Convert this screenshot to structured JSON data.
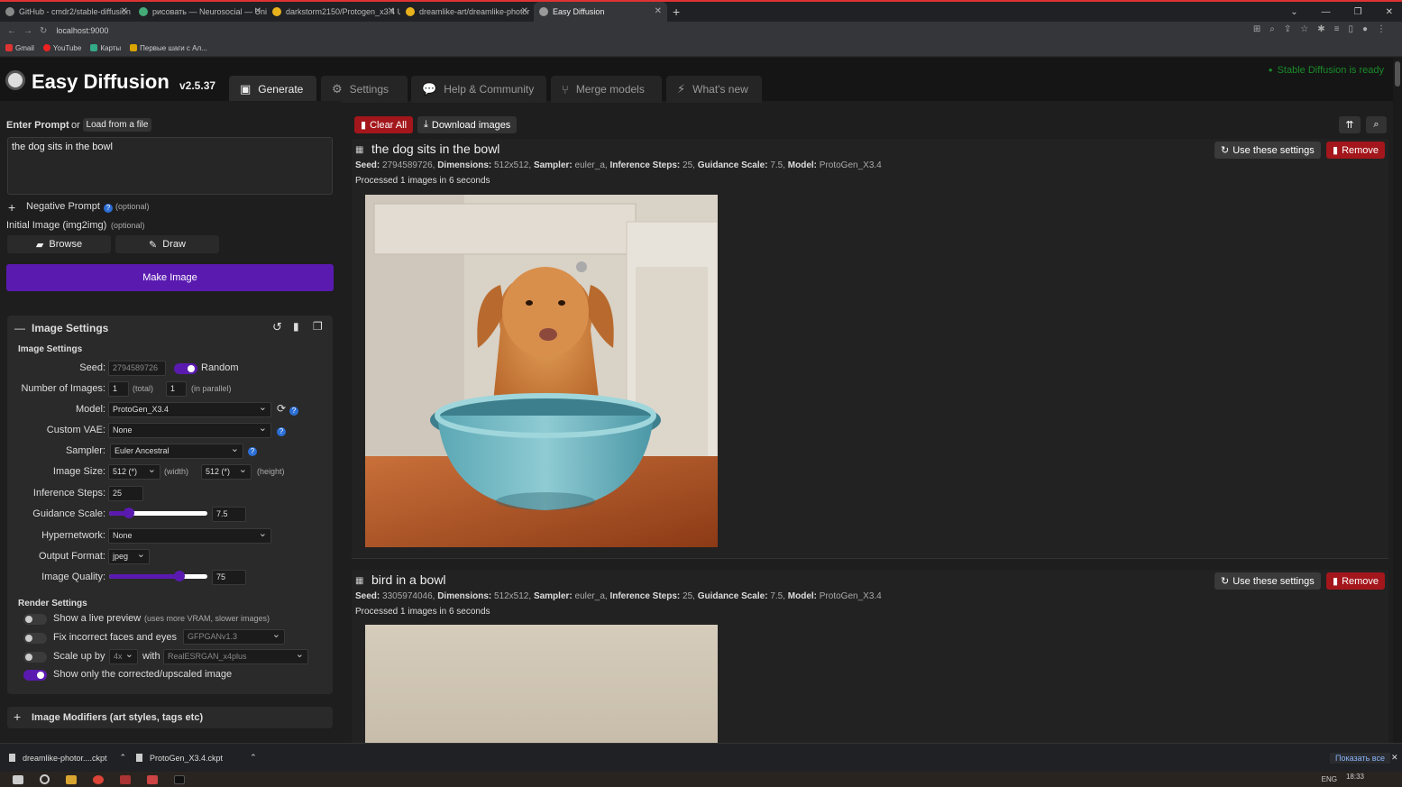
{
  "browser": {
    "tabs": [
      {
        "title": "GitHub - cmdr2/stable-diffusion",
        "icon": "github-icon"
      },
      {
        "title": "рисовать — Neurosocial — Uni",
        "icon": "site-icon"
      },
      {
        "title": "darkstorm2150/Protogen_x3.4 U",
        "icon": "huggingface-icon"
      },
      {
        "title": "dreamlike-art/dreamlike-photor",
        "icon": "huggingface-icon"
      },
      {
        "title": "Easy Diffusion",
        "icon": "easy-diffusion-icon"
      }
    ],
    "url": "localhost:9000",
    "bookmarks": [
      "Gmail",
      "YouTube",
      "Карты",
      "Первые шаги с Ал..."
    ]
  },
  "app": {
    "title": "Easy Diffusion",
    "version": "v2.5.37",
    "status": "Stable Diffusion is ready",
    "tabs": [
      {
        "label": "Generate",
        "icon": "image-icon"
      },
      {
        "label": "Settings",
        "icon": "gear-icon"
      },
      {
        "label": "Help & Community",
        "icon": "comments-icon"
      },
      {
        "label": "Merge models",
        "icon": "merge-icon"
      },
      {
        "label": "What's new",
        "icon": "bolt-icon"
      }
    ]
  },
  "left": {
    "enter_prompt": "Enter Prompt",
    "or": "or",
    "load_file": "Load from a file",
    "prompt_value": "the dog sits in the bowl",
    "negative_prompt": "Negative Prompt",
    "optional": "(optional)",
    "initial_image": "Initial Image (img2img)",
    "browse": "Browse",
    "draw": "Draw",
    "make_image": "Make Image"
  },
  "settings": {
    "panel_title": "Image Settings",
    "section_title": "Image Settings",
    "seed_label": "Seed:",
    "seed_value": "2794589726",
    "random_label": "Random",
    "num_images_label": "Number of Images:",
    "num_total": "1",
    "total_hint": "(total)",
    "num_parallel": "1",
    "parallel_hint": "(in parallel)",
    "model_label": "Model:",
    "model_value": "ProtoGen_X3.4",
    "vae_label": "Custom VAE:",
    "vae_value": "None",
    "sampler_label": "Sampler:",
    "sampler_value": "Euler Ancestral",
    "size_label": "Image Size:",
    "width_value": "512 (*)",
    "width_hint": "(width)",
    "height_value": "512 (*)",
    "height_hint": "(height)",
    "steps_label": "Inference Steps:",
    "steps_value": "25",
    "guidance_label": "Guidance Scale:",
    "guidance_value": "7.5",
    "guidance_level": 0.2,
    "hypernetwork_label": "Hypernetwork:",
    "hypernetwork_value": "None",
    "format_label": "Output Format:",
    "format_value": "jpeg",
    "quality_label": "Image Quality:",
    "quality_value": "75",
    "quality_level": 0.72,
    "render_title": "Render Settings",
    "live_preview": "Show a live preview",
    "live_hint": "(uses more VRAM, slower images)",
    "fix_faces": "Fix incorrect faces and eyes",
    "face_model": "GFPGANv1.3",
    "scale_up": "Scale up by",
    "scale_value": "4x",
    "with": "with",
    "upscaler": "RealESRGAN_x4plus",
    "show_corrected": "Show only the corrected/upscaled image",
    "modifiers_title": "Image Modifiers (art styles, tags etc)"
  },
  "right": {
    "clear_all": "Clear All",
    "download": "Download images",
    "use_settings": "Use these settings",
    "remove": "Remove",
    "tasks": [
      {
        "title": "the dog sits in the bowl",
        "seed": "2794589726",
        "dimensions": "512x512",
        "sampler": "euler_a",
        "steps": "25",
        "guidance": "7.5",
        "model": "ProtoGen_X3.4",
        "processed": "Processed 1 images in 6 seconds"
      },
      {
        "title": "bird in a bowl",
        "seed": "3305974046",
        "dimensions": "512x512",
        "sampler": "euler_a",
        "steps": "25",
        "guidance": "7.5",
        "model": "ProtoGen_X3.4",
        "processed": "Processed 1 images in 6 seconds"
      }
    ],
    "meta_labels": {
      "seed": "Seed:",
      "dimensions": "Dimensions:",
      "sampler": "Sampler:",
      "steps": "Inference Steps:",
      "guidance": "Guidance Scale:",
      "model": "Model:"
    }
  },
  "downloads": {
    "items": [
      "dreamlike-photor....ckpt",
      "ProtoGen_X3.4.ckpt"
    ],
    "show_all": "Показать все"
  },
  "taskbar": {
    "lang": "ENG",
    "time": "18:33"
  },
  "colors": {
    "accent": "#5a1ab0",
    "danger": "#a3161b",
    "ready": "#1a8a2a"
  }
}
